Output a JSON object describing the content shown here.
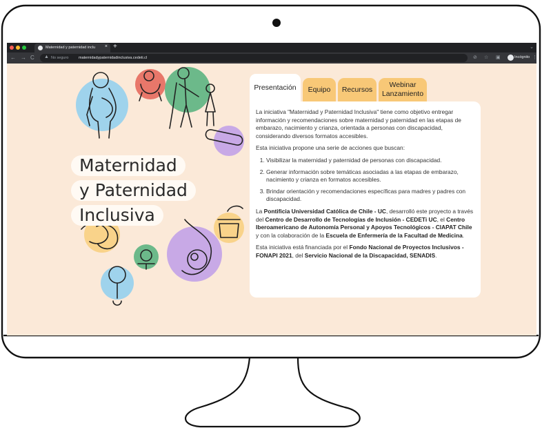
{
  "browser": {
    "tab_title": "Maternidad y paternidad inclu",
    "tab_close": "×",
    "new_tab": "+",
    "insecure_label": "No seguro",
    "url": "maternidadypaternidadinclusiva.cedeti.cl",
    "incognito_label": "Incógnito",
    "nav": {
      "back": "←",
      "forward": "→",
      "reload": "C"
    }
  },
  "hero": {
    "title_lines": [
      "Maternidad",
      "y Paternidad",
      "Inclusiva"
    ]
  },
  "tabs": [
    {
      "label": "Presentación",
      "active": true
    },
    {
      "label": "Equipo",
      "active": false
    },
    {
      "label": "Recursos",
      "active": false
    },
    {
      "label": "Webinar\nLanzamiento",
      "active": false
    }
  ],
  "content": {
    "intro": "La iniciativa \"Maternidad y Paternidad Inclusiva\" tiene como objetivo entregar información y recomendaciones sobre maternidad y paternidad en las etapas de embarazo, nacimiento y crianza, orientada a personas con discapacidad, considerando diversos formatos accesibles.",
    "actions_lead": "Esta iniciativa propone una serie de acciones que buscan:",
    "actions": [
      "Visibilizar la maternidad y paternidad de personas con discapacidad.",
      "Generar información sobre temáticas asociadas a las etapas de embarazo, nacimiento y crianza en formatos accesibles.",
      "Brindar orientación y recomendaciones específicas para madres y padres con discapacidad."
    ],
    "developers": {
      "t1": "La ",
      "b1": "Pontificia Universidad Católica de Chile - UC",
      "t2": ", desarrolló este proyecto a través del ",
      "b2": "Centro de Desarrollo de Tecnologías de Inclusión - CEDETi UC",
      "t3": ", el ",
      "b3": "Centro Iberoamericano de Autonomía Personal y Apoyos Tecnológicos - CIAPAT Chile",
      "t4": " y con la colaboración de la ",
      "b4": "Escuela de Enfermería de la Facultad de Medicina",
      "t5": "."
    },
    "funding": {
      "t1": "Esta iniciativa está financiada por el ",
      "b1": "Fondo Nacional de Proyectos Inclusivos - FONAPI 2021",
      "t2": ", del ",
      "b2": "Servicio Nacional de la Discapacidad, SENADIS",
      "t3": "."
    }
  },
  "colors": {
    "page_bg": "#fbe9d8",
    "tab_inactive": "#f8c877",
    "blue": "#9fd3ec",
    "red": "#e8776a",
    "green": "#6cb98a",
    "purple": "#c8a9e6",
    "yellow": "#f9d38a"
  },
  "icons": [
    "camera-icon",
    "chrome-icon",
    "lock-warning-icon",
    "star-icon",
    "incognito-icon",
    "pregnant-person-icon",
    "baby-icon",
    "family-icon",
    "pregnancy-test-icon",
    "sign-language-hands-icon",
    "pacifier-icon",
    "rattle-icon",
    "baby-food-icon",
    "fetus-icon"
  ]
}
